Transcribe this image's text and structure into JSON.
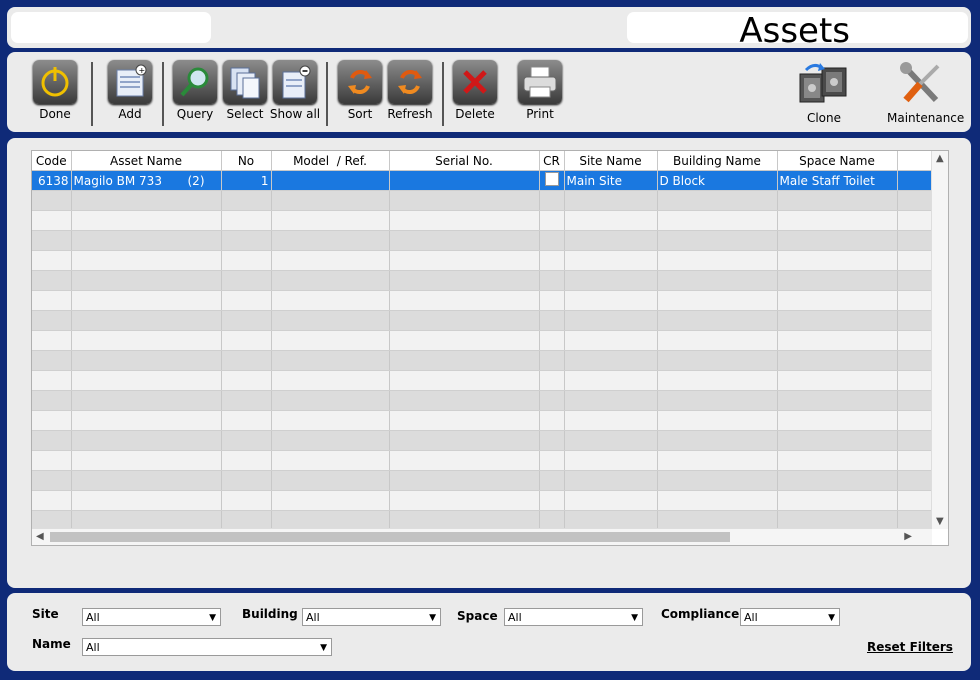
{
  "header": {
    "title": "Assets"
  },
  "toolbar": {
    "done": "Done",
    "add": "Add",
    "query": "Query",
    "select": "Select",
    "show_all": "Show all",
    "sort": "Sort",
    "refresh": "Refresh",
    "delete": "Delete",
    "print": "Print",
    "clone": "Clone",
    "maintenance": "Maintenance"
  },
  "grid": {
    "columns": [
      "Code",
      "Asset Name",
      "No",
      "Model  / Ref.",
      "Serial No.",
      "CR",
      "Site Name",
      "Building Name",
      "Space Name"
    ],
    "rows": [
      {
        "code": "6138",
        "asset_name": "Magilo BM 733",
        "asset_count": "(2)",
        "no": "1",
        "model": "",
        "serial": "",
        "cr": false,
        "site": "Main Site",
        "building": "D Block",
        "space": "Male Staff Toilet"
      }
    ]
  },
  "filters": {
    "site_label": "Site",
    "site_value": "All",
    "building_label": "Building",
    "building_value": "All",
    "space_label": "Space",
    "space_value": "All",
    "compliance_label": "Compliance",
    "compliance_value": "All",
    "name_label": "Name",
    "name_value": "All",
    "reset_label": "Reset Filters"
  },
  "icons": {
    "done": "power-icon",
    "add": "add-document-icon",
    "query": "magnifier-icon",
    "select": "copy-documents-icon",
    "show_all": "remove-document-icon",
    "sort": "sort-arrows-icon",
    "refresh": "refresh-arrows-icon",
    "delete": "x-icon",
    "print": "printer-icon",
    "clone": "safe-clone-icon",
    "maintenance": "wrench-screwdriver-icon"
  },
  "colors": {
    "selection": "#1a78e0",
    "frame": "#0f2a78",
    "panel": "#ebebeb"
  }
}
